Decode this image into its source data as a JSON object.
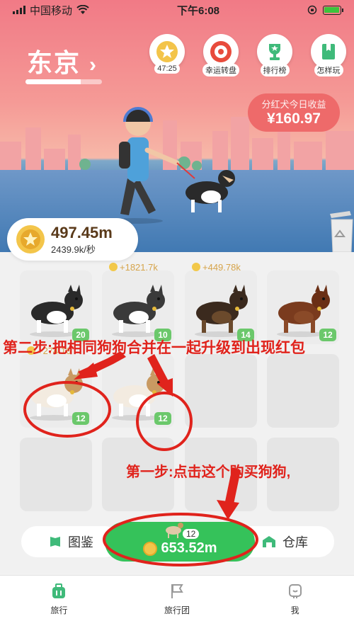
{
  "status": {
    "carrier": "中国移动",
    "time": "下午6:08"
  },
  "header": {
    "city": "东京",
    "city_arrow": "›",
    "city_progress_pct": 72
  },
  "top_icons": [
    {
      "name": "timer",
      "label": "47:25",
      "icon": "star-coin-icon"
    },
    {
      "name": "lucky-wheel",
      "label": "幸运转盘",
      "icon": "wheel-icon"
    },
    {
      "name": "leaderboard",
      "label": "排行榜",
      "icon": "trophy-icon"
    },
    {
      "name": "how-to-play",
      "label": "怎样玩",
      "icon": "book-icon"
    }
  ],
  "bonus": {
    "title": "分红犬今日收益",
    "amount": "¥160.97"
  },
  "coins": {
    "total": "497.45m",
    "rate": "2439.9k/秒"
  },
  "board": {
    "rows": [
      [
        {
          "level": "20",
          "earn": "",
          "dog": "collie"
        },
        {
          "level": "10",
          "earn": "+1821.7k",
          "dog": "husky"
        },
        {
          "level": "14",
          "earn": "+449.78k",
          "dog": "shiba"
        },
        {
          "level": "12",
          "earn": "",
          "dog": "dachshund"
        }
      ],
      [
        {
          "level": "12",
          "earn": "+274.16",
          "dog": "greyhound"
        },
        {
          "level": "12",
          "earn": "",
          "dog": "greyhound"
        },
        {
          "level": "",
          "earn": "",
          "dog": ""
        },
        {
          "level": "",
          "earn": "",
          "dog": ""
        }
      ],
      [
        {
          "level": "",
          "earn": "",
          "dog": ""
        },
        {
          "level": "",
          "earn": "",
          "dog": ""
        },
        {
          "level": "",
          "earn": "",
          "dog": ""
        },
        {
          "level": "",
          "earn": "",
          "dog": ""
        }
      ]
    ]
  },
  "actions": {
    "catalog": "图鉴",
    "buy_level": "12",
    "buy_price": "653.52m",
    "warehouse": "仓库"
  },
  "tabs": [
    {
      "label": "旅行",
      "icon": "suitcase-icon"
    },
    {
      "label": "旅行团",
      "icon": "flag-icon"
    },
    {
      "label": "我",
      "icon": "person-icon"
    }
  ],
  "annotations": {
    "step2": "第二步:把相同狗狗合并在一起升级到出现红包",
    "step1": "第一步:点击这个购买狗狗,"
  },
  "colors": {
    "accent_green": "#35c25a",
    "annotation_red": "#e0231c",
    "bonus_red": "#ee6a6a"
  }
}
